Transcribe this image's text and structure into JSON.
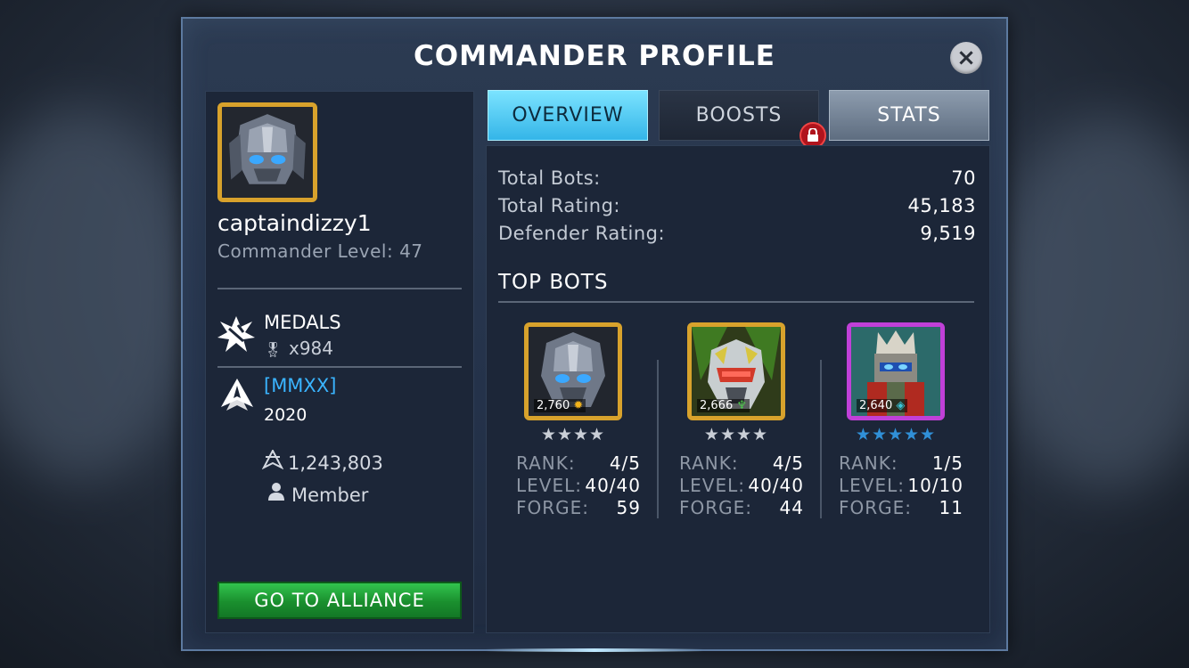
{
  "title": "COMMANDER PROFILE",
  "close_label": "×",
  "profile": {
    "username": "captaindizzy1",
    "commander_level": "Commander Level: 47",
    "medals_label": "MEDALS",
    "medals_count": "x984",
    "alliance_tag": "[MMXX]",
    "alliance_name": "2020",
    "alliance_score": "1,243,803",
    "alliance_role": "Member",
    "go_to_alliance": "GO TO ALLIANCE"
  },
  "tabs": [
    {
      "label": "OVERVIEW",
      "active": true
    },
    {
      "label": "BOOSTS",
      "locked": true
    },
    {
      "label": "STATS"
    }
  ],
  "stats": [
    {
      "label": "Total Bots:",
      "value": "70"
    },
    {
      "label": "Total Rating:",
      "value": "45,183"
    },
    {
      "label": "Defender Rating:",
      "value": "9,519"
    }
  ],
  "top_bots_label": "TOP BOTS",
  "bots": [
    {
      "power": "2,760",
      "stars": "★★★★",
      "rank_label": "RANK:",
      "rank": "4/5",
      "level_label": "LEVEL:",
      "level": "40/40",
      "forge_label": "FORGE:",
      "forge": "59"
    },
    {
      "power": "2,666",
      "stars": "★★★★",
      "rank_label": "RANK:",
      "rank": "4/5",
      "level_label": "LEVEL:",
      "level": "40/40",
      "forge_label": "FORGE:",
      "forge": "44"
    },
    {
      "power": "2,640",
      "stars": "★★★★★",
      "rank_label": "RANK:",
      "rank": "1/5",
      "level_label": "LEVEL:",
      "level": "10/10",
      "forge_label": "FORGE:",
      "forge": "11"
    }
  ],
  "colors": {
    "accent_tab": "#34b5e8",
    "alliance_tag": "#3ab4ff",
    "button_green": "#1a8f2e",
    "frame_gold": "#d8a22c",
    "frame_purple": "#c040d8"
  }
}
